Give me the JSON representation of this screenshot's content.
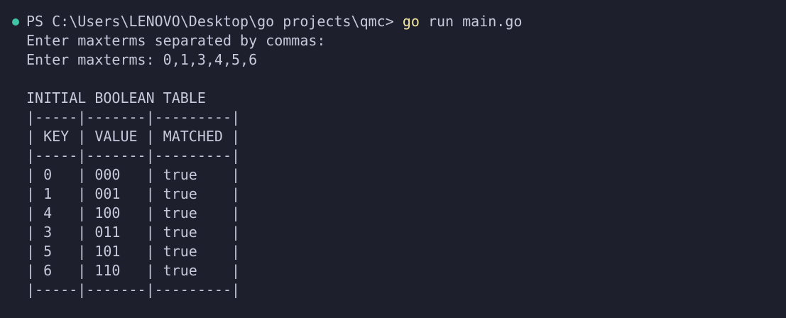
{
  "terminal": {
    "prompt": "PS C:\\Users\\LENOVO\\Desktop\\go projects\\qmc>",
    "command_program": "go",
    "command_args": "run main.go",
    "output": [
      "Enter maxterms separated by commas:",
      "Enter maxterms: 0,1,3,4,5,6",
      "",
      "INITIAL BOOLEAN TABLE",
      "|-----|-------|---------|",
      "| KEY | VALUE | MATCHED |",
      "|-----|-------|---------|",
      "| 0   | 000   | true    |",
      "| 1   | 001   | true    |",
      "| 4   | 100   | true    |",
      "| 3   | 011   | true    |",
      "| 5   | 101   | true    |",
      "| 6   | 110   | true    |",
      "|-----|-------|---------|"
    ]
  },
  "colors": {
    "background": "#1e1f2c",
    "text": "#c6c9db",
    "command_highlight": "#f2e6a0",
    "status_dot": "#3fc5a6"
  }
}
